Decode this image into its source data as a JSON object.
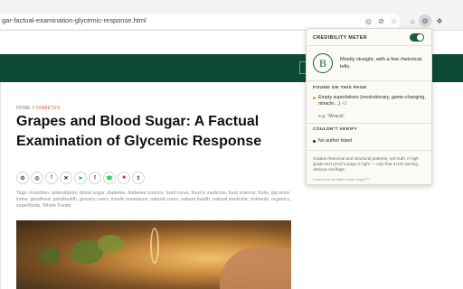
{
  "browser": {
    "url": "gar-factual-examination-glycemic-response.html",
    "omnibox_icons": [
      "translate-icon",
      "eye-off-icon",
      "star-icon"
    ],
    "toolbar_icons": [
      "home-icon",
      "extension-active-icon",
      "puzzle-icon"
    ]
  },
  "site": {
    "breadcrumb_home": "HOME",
    "breadcrumb_sep": " // ",
    "breadcrumb_category": "DIABETES",
    "article_title": "Grapes and Blood Sugar: A Factual Examination of Glycemic Response",
    "share_buttons": [
      {
        "icon": "copy-link-icon",
        "glyph": "⚙",
        "color": "#444444"
      },
      {
        "icon": "reddit-icon",
        "glyph": "◎",
        "color": "#444444"
      },
      {
        "icon": "facebook-icon",
        "glyph": "f",
        "color": "#1877f2"
      },
      {
        "icon": "x-icon",
        "glyph": "✕",
        "color": "#111111"
      },
      {
        "icon": "telegram-icon",
        "glyph": "➤",
        "color": "#229ed9"
      },
      {
        "icon": "tumblr-icon",
        "glyph": "t",
        "color": "#36465d"
      },
      {
        "icon": "whatsapp-icon",
        "glyph": "☎",
        "color": "#25d366"
      },
      {
        "icon": "flipboard-icon",
        "glyph": "■",
        "color": "#e12828"
      },
      {
        "icon": "share-icon",
        "glyph": "⇪",
        "color": "#444444"
      }
    ],
    "tags": "Tags: #nutrition, antioxidants, blood sugar, diabetes, diabetes science, food cures, food is medicine, food science, fruits, glycemic index, goodfood, goodhealth, grocery cures, insulin resistance, natural cures, natural health, natural medicine, nutrients, organics, superfoods, Whole Foods"
  },
  "popup": {
    "title": "CREDIBILITY METER",
    "grade": "B",
    "grade_description": "Mostly straight, with a few rhetorical tells.",
    "found_title": "FOUND ON THIS PAGE",
    "found_item": "Empty superlatives (revolutionary, game-changing, miracle…)",
    "found_count": "×2",
    "found_example": "e.g. “Miracle”",
    "verify_title": "COULDN'T VERIFY",
    "verify_item": "No author listed",
    "footer_note": "Grades rhetorical and structural patterns, not truth. A high grade isn't proof a page is right — only that it isn't waving obvious red flags.",
    "powered_by": "Powered by the Warm Amber Engine™",
    "toggle_on": true,
    "colors": {
      "accent": "#1f5a3f",
      "found_dot": "#d4a017",
      "verify_dot": "#2c2c2c"
    }
  }
}
